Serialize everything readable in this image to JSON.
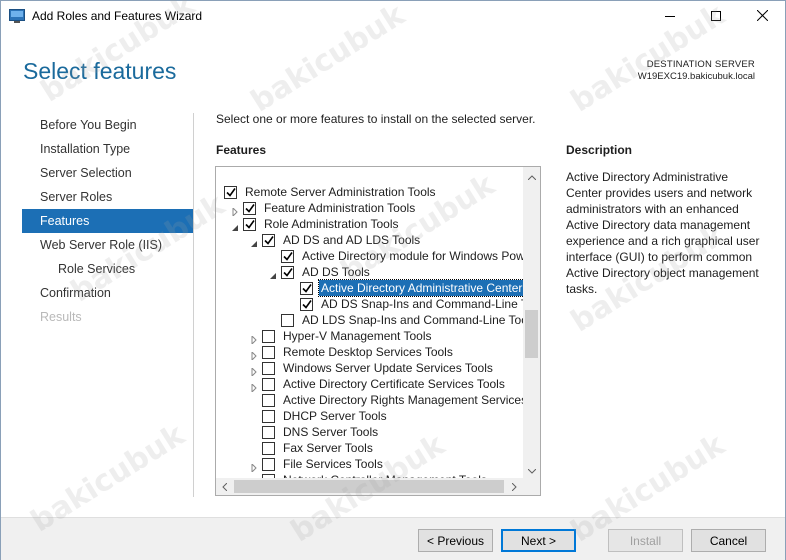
{
  "window": {
    "title": "Add Roles and Features Wizard",
    "icon": "server-manager-icon"
  },
  "header": {
    "page_title": "Select features",
    "destination_label": "DESTINATION SERVER",
    "destination_server": "W19EXC19.bakicubuk.local"
  },
  "nav": {
    "items": [
      {
        "label": "Before You Begin",
        "state": "normal"
      },
      {
        "label": "Installation Type",
        "state": "normal"
      },
      {
        "label": "Server Selection",
        "state": "normal"
      },
      {
        "label": "Server Roles",
        "state": "normal"
      },
      {
        "label": "Features",
        "state": "active"
      },
      {
        "label": "Web Server Role (IIS)",
        "state": "normal"
      },
      {
        "label": "Role Services",
        "state": "sub"
      },
      {
        "label": "Confirmation",
        "state": "normal"
      },
      {
        "label": "Results",
        "state": "disabled"
      }
    ]
  },
  "main": {
    "instruction": "Select one or more features to install on the selected server.",
    "features_heading": "Features",
    "description_heading": "Description",
    "description": "Active Directory Administrative Center provides users and network administrators with an enhanced Active Directory data management experience and a rich graphical user interface (GUI) to perform common Active Directory object management tasks.",
    "tree": [
      {
        "label": "Remote Server Administration Tools",
        "level": 0,
        "expander": "none",
        "checked": true
      },
      {
        "label": "Feature Administration Tools",
        "level": 1,
        "expander": "collapsed",
        "checked": true
      },
      {
        "label": "Role Administration Tools",
        "level": 1,
        "expander": "expanded",
        "checked": true
      },
      {
        "label": "AD DS and AD LDS Tools",
        "level": 2,
        "expander": "expanded",
        "checked": true
      },
      {
        "label": "Active Directory module for Windows PowerShell",
        "level": 3,
        "expander": "none",
        "checked": true
      },
      {
        "label": "AD DS Tools",
        "level": 3,
        "expander": "expanded",
        "checked": true
      },
      {
        "label": "Active Directory Administrative Center",
        "level": 4,
        "expander": "none",
        "checked": true,
        "selected": true
      },
      {
        "label": "AD DS Snap-Ins and Command-Line Tools",
        "level": 4,
        "expander": "none",
        "checked": true
      },
      {
        "label": "AD LDS Snap-Ins and Command-Line Tools",
        "level": 3,
        "expander": "none",
        "checked": false
      },
      {
        "label": "Hyper-V Management Tools",
        "level": 2,
        "expander": "collapsed",
        "checked": false
      },
      {
        "label": "Remote Desktop Services Tools",
        "level": 2,
        "expander": "collapsed",
        "checked": false
      },
      {
        "label": "Windows Server Update Services Tools",
        "level": 2,
        "expander": "collapsed",
        "checked": false
      },
      {
        "label": "Active Directory Certificate Services Tools",
        "level": 2,
        "expander": "collapsed",
        "checked": false
      },
      {
        "label": "Active Directory Rights Management Services Tools",
        "level": 2,
        "expander": "none",
        "checked": false
      },
      {
        "label": "DHCP Server Tools",
        "level": 2,
        "expander": "none",
        "checked": false
      },
      {
        "label": "DNS Server Tools",
        "level": 2,
        "expander": "none",
        "checked": false
      },
      {
        "label": "Fax Server Tools",
        "level": 2,
        "expander": "none",
        "checked": false
      },
      {
        "label": "File Services Tools",
        "level": 2,
        "expander": "collapsed",
        "checked": false
      },
      {
        "label": "Network Controller Management Tools",
        "level": 2,
        "expander": "none",
        "checked": false
      }
    ]
  },
  "footer": {
    "previous_label": "< Previous",
    "next_label": "Next >",
    "install_label": "Install",
    "cancel_label": "Cancel"
  },
  "watermark": "bakicubuk",
  "colors": {
    "accent": "#1c6fb5",
    "title_blue": "#1a6a9c"
  }
}
